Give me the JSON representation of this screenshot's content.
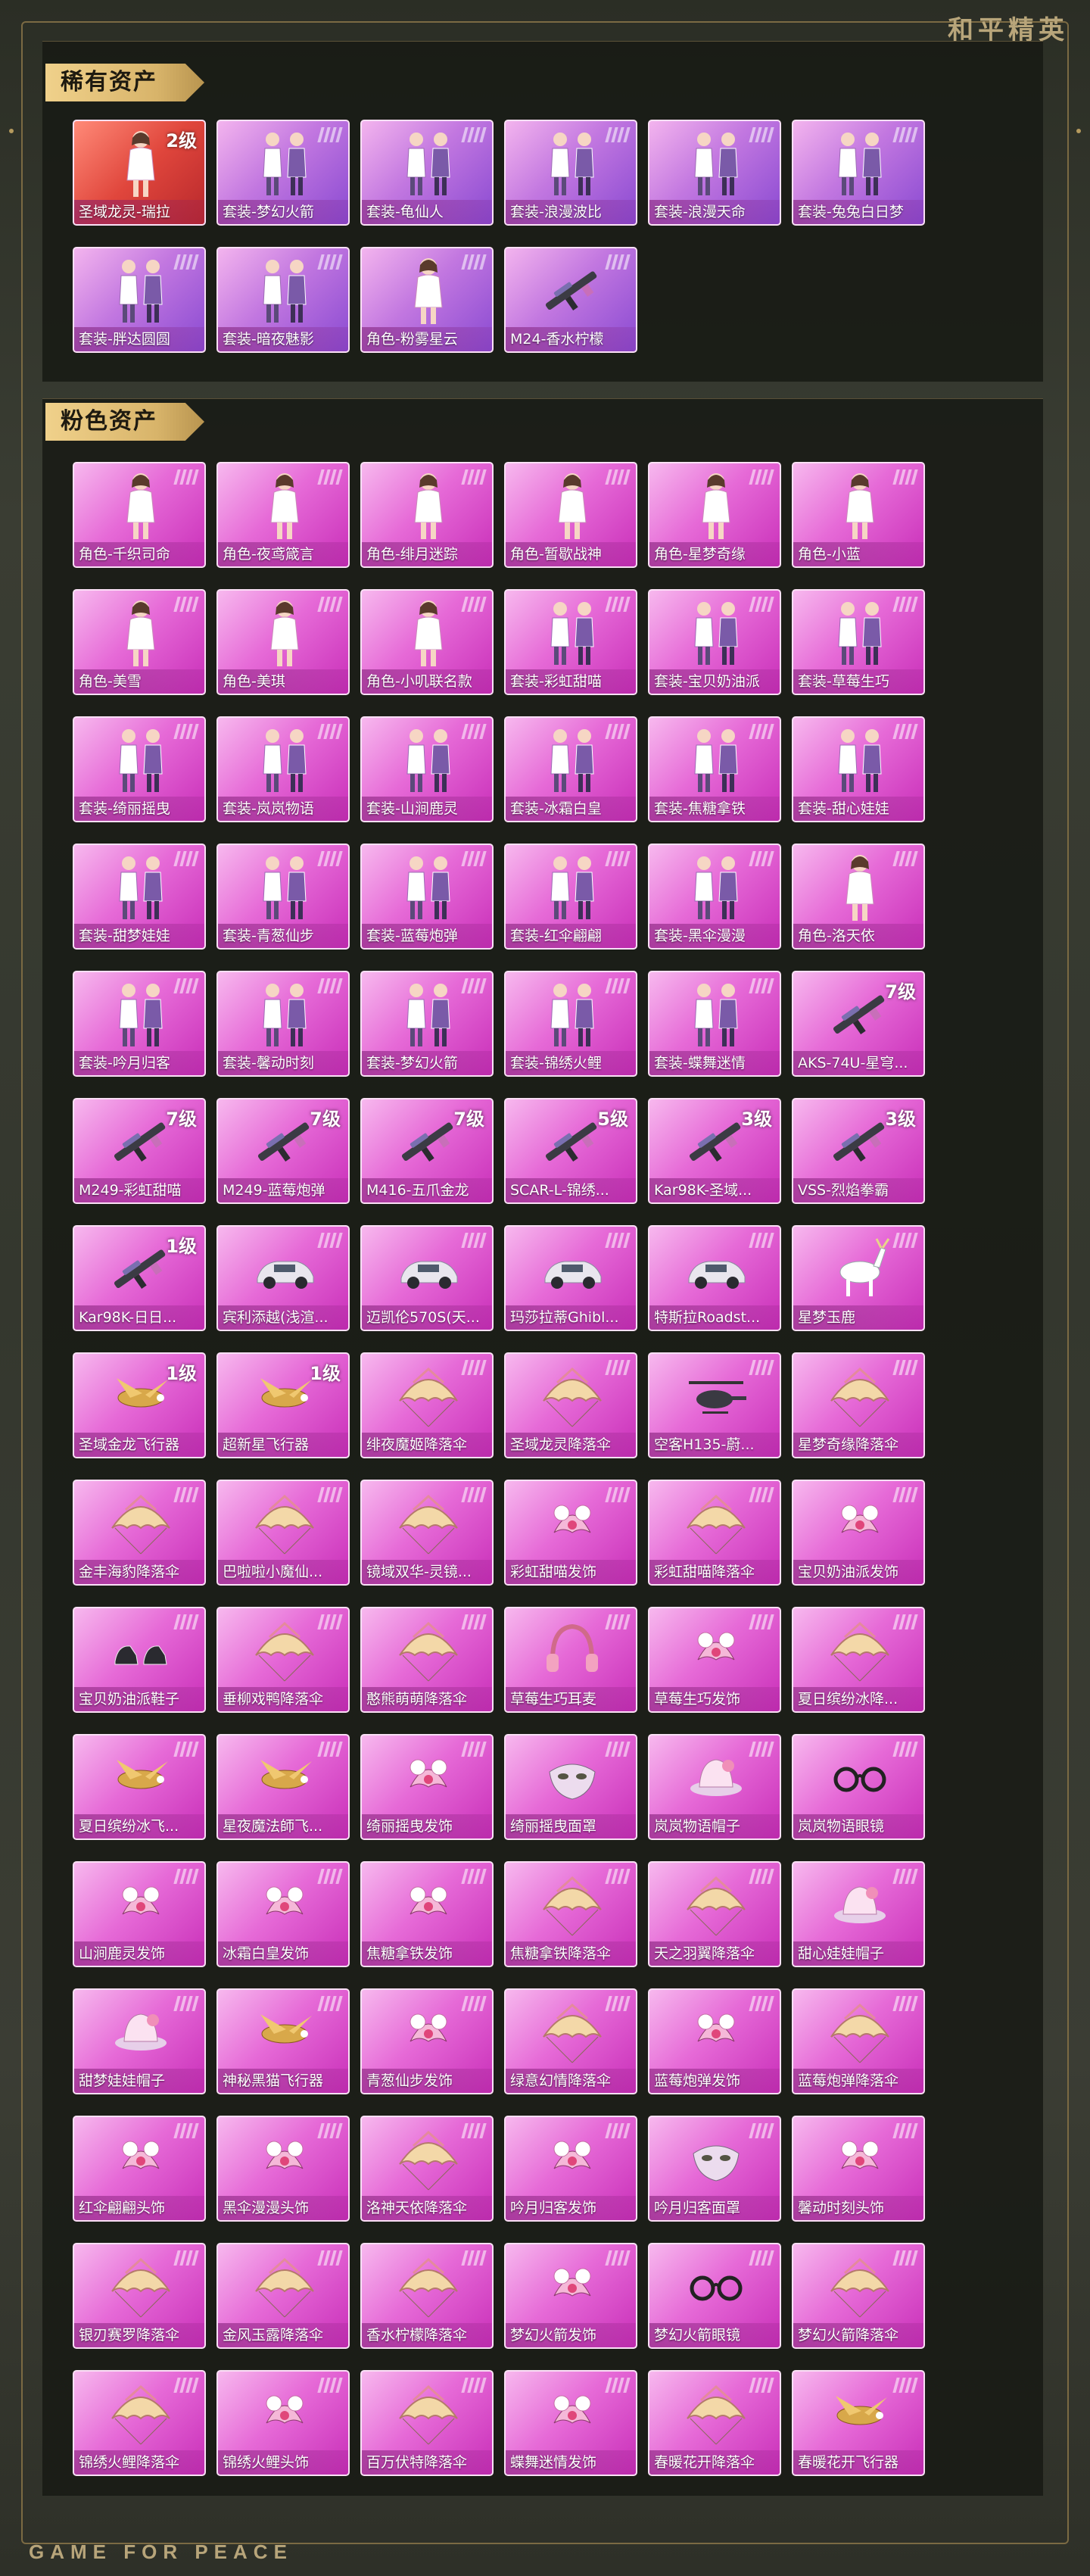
{
  "brand_top": "和平精英",
  "brand_bottom": "GAME FOR PEACE",
  "colors": {
    "accent_gold": "#d8b46a",
    "card_pink": "#e66ad7",
    "card_purple": "#8a4ad2",
    "card_red": "#e0463c"
  },
  "sections": [
    {
      "title": "稀有资产",
      "items": [
        {
          "label": "圣域龙灵-瑞拉",
          "level": "2级",
          "style": "red",
          "icon": "character-icon"
        },
        {
          "label": "套装-梦幻火箭",
          "level": "",
          "style": "rare",
          "icon": "outfit-icon"
        },
        {
          "label": "套装-龟仙人",
          "level": "",
          "style": "rare",
          "icon": "outfit-icon"
        },
        {
          "label": "套装-浪漫波比",
          "level": "",
          "style": "rare",
          "icon": "outfit-icon"
        },
        {
          "label": "套装-浪漫天命",
          "level": "",
          "style": "rare",
          "icon": "outfit-icon"
        },
        {
          "label": "套装-兔兔白日梦",
          "level": "",
          "style": "rare",
          "icon": "outfit-icon"
        },
        {
          "label": "套装-胖达圆圆",
          "level": "",
          "style": "rare",
          "icon": "outfit-icon"
        },
        {
          "label": "套装-暗夜魅影",
          "level": "",
          "style": "rare",
          "icon": "outfit-icon"
        },
        {
          "label": "角色-粉雾星云",
          "level": "",
          "style": "rare",
          "icon": "character-icon"
        },
        {
          "label": "M24-香水柠檬",
          "level": "",
          "style": "rare",
          "icon": "rifle-icon"
        }
      ]
    },
    {
      "title": "粉色资产",
      "items": [
        {
          "label": "角色-千织司命",
          "level": "",
          "icon": "character-icon"
        },
        {
          "label": "角色-夜鸢箴言",
          "level": "",
          "icon": "character-icon"
        },
        {
          "label": "角色-绯月迷踪",
          "level": "",
          "icon": "character-icon"
        },
        {
          "label": "角色-暂歇战神",
          "level": "",
          "icon": "character-icon"
        },
        {
          "label": "角色-星梦奇缘",
          "level": "",
          "icon": "character-icon"
        },
        {
          "label": "角色-小蓝",
          "level": "",
          "icon": "character-icon"
        },
        {
          "label": "角色-美雪",
          "level": "",
          "icon": "character-icon"
        },
        {
          "label": "角色-美琪",
          "level": "",
          "icon": "character-icon"
        },
        {
          "label": "角色-小叽联名款",
          "level": "",
          "icon": "character-icon"
        },
        {
          "label": "套装-彩虹甜喵",
          "level": "",
          "icon": "outfit-icon"
        },
        {
          "label": "套装-宝贝奶油派",
          "level": "",
          "icon": "outfit-icon"
        },
        {
          "label": "套装-草莓生巧",
          "level": "",
          "icon": "outfit-icon"
        },
        {
          "label": "套装-绮丽摇曳",
          "level": "",
          "icon": "outfit-icon"
        },
        {
          "label": "套装-岚岚物语",
          "level": "",
          "icon": "outfit-icon"
        },
        {
          "label": "套装-山涧鹿灵",
          "level": "",
          "icon": "outfit-icon"
        },
        {
          "label": "套装-冰霜白皇",
          "level": "",
          "icon": "outfit-icon"
        },
        {
          "label": "套装-焦糖拿铁",
          "level": "",
          "icon": "outfit-icon"
        },
        {
          "label": "套装-甜心娃娃",
          "level": "",
          "icon": "outfit-icon"
        },
        {
          "label": "套装-甜梦娃娃",
          "level": "",
          "icon": "outfit-icon"
        },
        {
          "label": "套装-青葱仙步",
          "level": "",
          "icon": "outfit-icon"
        },
        {
          "label": "套装-蓝莓炮弹",
          "level": "",
          "icon": "outfit-icon"
        },
        {
          "label": "套装-红伞翩翩",
          "level": "",
          "icon": "outfit-icon"
        },
        {
          "label": "套装-黑伞漫漫",
          "level": "",
          "icon": "outfit-icon"
        },
        {
          "label": "角色-洛天依",
          "level": "",
          "icon": "character-icon"
        },
        {
          "label": "套装-吟月归客",
          "level": "",
          "icon": "outfit-icon"
        },
        {
          "label": "套装-馨动时刻",
          "level": "",
          "icon": "outfit-icon"
        },
        {
          "label": "套装-梦幻火箭",
          "level": "",
          "icon": "outfit-icon"
        },
        {
          "label": "套装-锦绣火鲤",
          "level": "",
          "icon": "outfit-icon"
        },
        {
          "label": "套装-蝶舞迷情",
          "level": "",
          "icon": "outfit-icon"
        },
        {
          "label": "AKS-74U-星穹...",
          "level": "7级",
          "icon": "rifle-icon"
        },
        {
          "label": "M249-彩虹甜喵",
          "level": "7级",
          "icon": "rifle-icon"
        },
        {
          "label": "M249-蓝莓炮弹",
          "level": "7级",
          "icon": "rifle-icon"
        },
        {
          "label": "M416-五爪金龙",
          "level": "7级",
          "icon": "rifle-icon"
        },
        {
          "label": "SCAR-L-锦绣...",
          "level": "5级",
          "icon": "rifle-icon"
        },
        {
          "label": "Kar98K-圣域...",
          "level": "3级",
          "icon": "rifle-icon"
        },
        {
          "label": "VSS-烈焰拳霸",
          "level": "3级",
          "icon": "rifle-icon"
        },
        {
          "label": "Kar98K-日日...",
          "level": "1级",
          "icon": "rifle-icon"
        },
        {
          "label": "宾利添越(浅渲...",
          "level": "",
          "icon": "car-icon"
        },
        {
          "label": "迈凯伦570S(天...",
          "level": "",
          "icon": "car-icon"
        },
        {
          "label": "玛莎拉蒂Ghibl...",
          "level": "",
          "icon": "car-icon"
        },
        {
          "label": "特斯拉Roadst...",
          "level": "",
          "icon": "car-icon"
        },
        {
          "label": "星梦玉鹿",
          "level": "",
          "icon": "mount-icon"
        },
        {
          "label": "圣域金龙飞行器",
          "level": "1级",
          "icon": "aircraft-icon"
        },
        {
          "label": "超新星飞行器",
          "level": "1级",
          "icon": "aircraft-icon"
        },
        {
          "label": "绯夜魔姬降落伞",
          "level": "",
          "icon": "parachute-icon"
        },
        {
          "label": "圣域龙灵降落伞",
          "level": "",
          "icon": "parachute-icon"
        },
        {
          "label": "空客H135-蔚...",
          "level": "",
          "icon": "helicopter-icon"
        },
        {
          "label": "星梦奇缘降落伞",
          "level": "",
          "icon": "parachute-icon"
        },
        {
          "label": "金丰海豹降落伞",
          "level": "",
          "icon": "parachute-icon"
        },
        {
          "label": "巴啦啦小魔仙...",
          "level": "",
          "icon": "parachute-icon"
        },
        {
          "label": "镜域双华-灵镜...",
          "level": "",
          "icon": "parachute-icon"
        },
        {
          "label": "彩虹甜喵发饰",
          "level": "",
          "icon": "headwear-icon"
        },
        {
          "label": "彩虹甜喵降落伞",
          "level": "",
          "icon": "parachute-icon"
        },
        {
          "label": "宝贝奶油派发饰",
          "level": "",
          "icon": "headwear-icon"
        },
        {
          "label": "宝贝奶油派鞋子",
          "level": "",
          "icon": "shoes-icon"
        },
        {
          "label": "垂柳戏鸭降落伞",
          "level": "",
          "icon": "parachute-icon"
        },
        {
          "label": "憨熊萌萌降落伞",
          "level": "",
          "icon": "parachute-icon"
        },
        {
          "label": "草莓生巧耳麦",
          "level": "",
          "icon": "headset-icon"
        },
        {
          "label": "草莓生巧发饰",
          "level": "",
          "icon": "headwear-icon"
        },
        {
          "label": "夏日缤纷冰降...",
          "level": "",
          "icon": "parachute-icon"
        },
        {
          "label": "夏日缤纷冰飞...",
          "level": "",
          "icon": "aircraft-icon"
        },
        {
          "label": "星夜魔法師飞...",
          "level": "",
          "icon": "aircraft-icon"
        },
        {
          "label": "绮丽摇曳发饰",
          "level": "",
          "icon": "headwear-icon"
        },
        {
          "label": "绮丽摇曳面罩",
          "level": "",
          "icon": "mask-icon"
        },
        {
          "label": "岚岚物语帽子",
          "level": "",
          "icon": "hat-icon"
        },
        {
          "label": "岚岚物语眼镜",
          "level": "",
          "icon": "glasses-icon"
        },
        {
          "label": "山涧鹿灵发饰",
          "level": "",
          "icon": "headwear-icon"
        },
        {
          "label": "冰霜白皇发饰",
          "level": "",
          "icon": "headwear-icon"
        },
        {
          "label": "焦糖拿铁发饰",
          "level": "",
          "icon": "headwear-icon"
        },
        {
          "label": "焦糖拿铁降落伞",
          "level": "",
          "icon": "parachute-icon"
        },
        {
          "label": "天之羽翼降落伞",
          "level": "",
          "icon": "parachute-icon"
        },
        {
          "label": "甜心娃娃帽子",
          "level": "",
          "icon": "hat-icon"
        },
        {
          "label": "甜梦娃娃帽子",
          "level": "",
          "icon": "hat-icon"
        },
        {
          "label": "神秘黑猫飞行器",
          "level": "",
          "icon": "aircraft-icon"
        },
        {
          "label": "青葱仙步发饰",
          "level": "",
          "icon": "headwear-icon"
        },
        {
          "label": "绿意幻情降落伞",
          "level": "",
          "icon": "parachute-icon"
        },
        {
          "label": "蓝莓炮弹发饰",
          "level": "",
          "icon": "headwear-icon"
        },
        {
          "label": "蓝莓炮弹降落伞",
          "level": "",
          "icon": "parachute-icon"
        },
        {
          "label": "红伞翩翩头饰",
          "level": "",
          "icon": "headwear-icon"
        },
        {
          "label": "黑伞漫漫头饰",
          "level": "",
          "icon": "headwear-icon"
        },
        {
          "label": "洛神天依降落伞",
          "level": "",
          "icon": "parachute-icon"
        },
        {
          "label": "吟月归客发饰",
          "level": "",
          "icon": "headwear-icon"
        },
        {
          "label": "吟月归客面罩",
          "level": "",
          "icon": "mask-icon"
        },
        {
          "label": "馨动时刻头饰",
          "level": "",
          "icon": "headwear-icon"
        },
        {
          "label": "银刃赛罗降落伞",
          "level": "",
          "icon": "parachute-icon"
        },
        {
          "label": "金风玉露降落伞",
          "level": "",
          "icon": "parachute-icon"
        },
        {
          "label": "香水柠檬降落伞",
          "level": "",
          "icon": "parachute-icon"
        },
        {
          "label": "梦幻火箭发饰",
          "level": "",
          "icon": "headwear-icon"
        },
        {
          "label": "梦幻火箭眼镜",
          "level": "",
          "icon": "glasses-icon"
        },
        {
          "label": "梦幻火箭降落伞",
          "level": "",
          "icon": "parachute-icon"
        },
        {
          "label": "锦绣火鲤降落伞",
          "level": "",
          "icon": "parachute-icon"
        },
        {
          "label": "锦绣火鲤头饰",
          "level": "",
          "icon": "headwear-icon"
        },
        {
          "label": "百万伏特降落伞",
          "level": "",
          "icon": "parachute-icon"
        },
        {
          "label": "蝶舞迷情发饰",
          "level": "",
          "icon": "headwear-icon"
        },
        {
          "label": "春暖花开降落伞",
          "level": "",
          "icon": "parachute-icon"
        },
        {
          "label": "春暖花开飞行器",
          "level": "",
          "icon": "aircraft-icon"
        }
      ]
    }
  ]
}
